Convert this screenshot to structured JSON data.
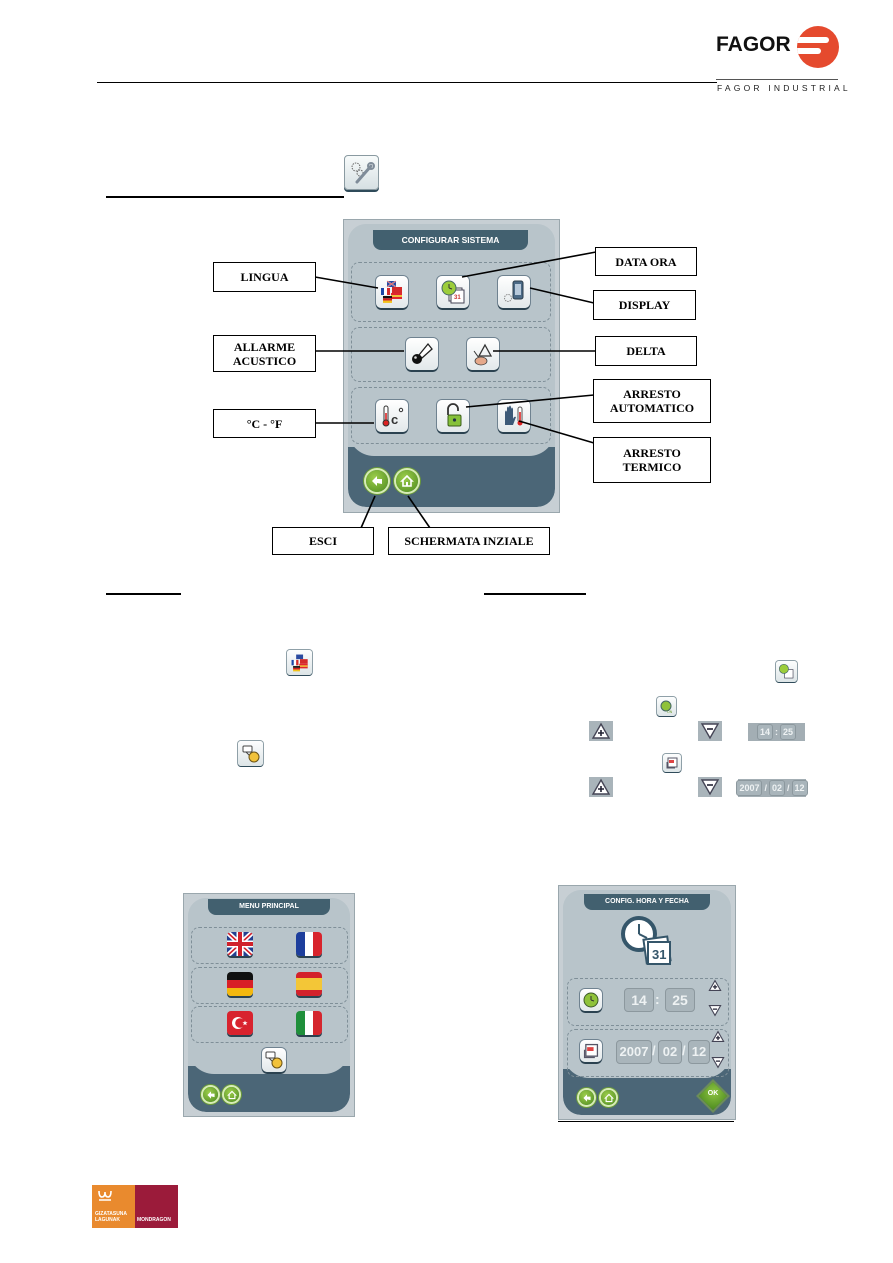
{
  "header": {
    "brand": "FAGOR",
    "brand_sub": "FAGOR INDUSTRIAL",
    "brand_color": "#e54a2e"
  },
  "section": {
    "icon": "gear-wrench-icon"
  },
  "main_screen": {
    "title": "CONFIGURAR SISTEMA",
    "rows": [
      [
        {
          "icon": "flags-language-icon"
        },
        {
          "icon": "clock-calendar-icon"
        },
        {
          "icon": "display-gear-icon"
        }
      ],
      [
        {
          "icon": "horn-icon"
        },
        {
          "icon": "delta-icon"
        }
      ],
      [
        {
          "icon": "thermometer-celsius-icon"
        },
        {
          "icon": "padlock-open-icon"
        },
        {
          "icon": "hand-thermometer-icon"
        }
      ]
    ],
    "footer_buttons": [
      {
        "icon": "back-arrow-icon"
      },
      {
        "icon": "home-icon"
      }
    ]
  },
  "callouts": {
    "lingua": "LINGUA",
    "data_ora": "DATA ORA",
    "display": "DISPLAY",
    "allarme_1": "ALLARME",
    "allarme_2": "ACUSTICO",
    "delta": "DELTA",
    "arresto_auto_1": "ARRESTO",
    "arresto_auto_2": "AUTOMATICO",
    "celsius": "°C - °F",
    "arresto_term_1": "ARRESTO",
    "arresto_term_2": "TERMICO",
    "esci": "ESCI",
    "schermata": "SCHERMATA INZIALE"
  },
  "time_inline": {
    "hour": "14",
    "minute": "25",
    "sep": ":"
  },
  "date_inline": {
    "year": "2007",
    "month": "02",
    "day": "12",
    "sep": "/"
  },
  "menu_principal": {
    "title": "MENU PRINCIPAL",
    "flags": [
      "United Kingdom",
      "France",
      "Germany",
      "Spain",
      "Turkey",
      "Italy"
    ]
  },
  "config_hora": {
    "title": "CONFIG. HORA Y FECHA",
    "hour": "14",
    "minute": "25",
    "time_sep": ":",
    "year": "2007",
    "month": "02",
    "day": "12",
    "date_sep": "/",
    "ok_label": "OK"
  },
  "footer_logo": {
    "left_text_1": "GIZATASUNA",
    "left_text_2": "LAGUNAK",
    "right_text": "MONDRAGON"
  }
}
